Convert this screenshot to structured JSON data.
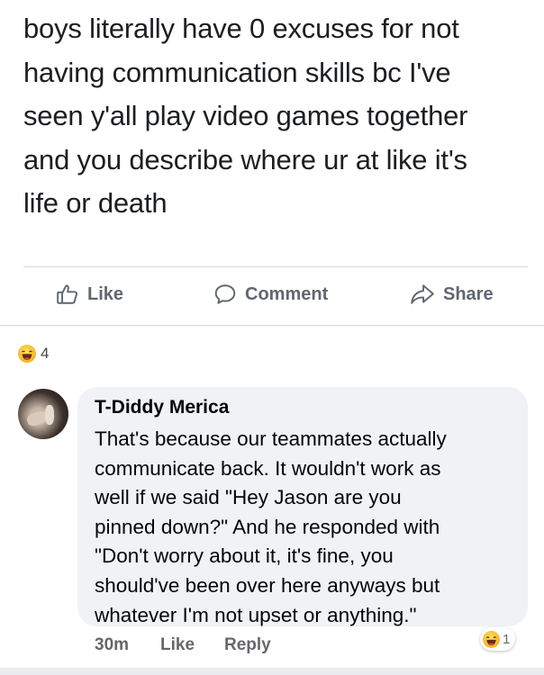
{
  "post": {
    "text_lines": [
      "boys literally have 0 excuses for not",
      "having communication skills bc I've",
      "seen y'all play video games together",
      "and you describe where ur at like it's",
      "life or death"
    ]
  },
  "actions": {
    "like": "Like",
    "comment": "Comment",
    "share": "Share"
  },
  "reactions": {
    "icon": "haha-emoji-icon",
    "count": "4"
  },
  "comment": {
    "author": "T-Diddy Merica",
    "text_lines": [
      "That's because our teammates actually",
      "communicate back. It wouldn't work as",
      "well if we said \"Hey Jason are you",
      "pinned down?\" And he responded with",
      "\"Don't worry about it, it's fine, you",
      "should've been over here anyways but",
      "whatever I'm not upset or anything.\""
    ],
    "time": "30m",
    "like_label": "Like",
    "reply_label": "Reply",
    "reaction_count": "1"
  },
  "colors": {
    "bubble": "#f0f2f5",
    "action_text": "#606770",
    "haha": "#f5b521"
  }
}
